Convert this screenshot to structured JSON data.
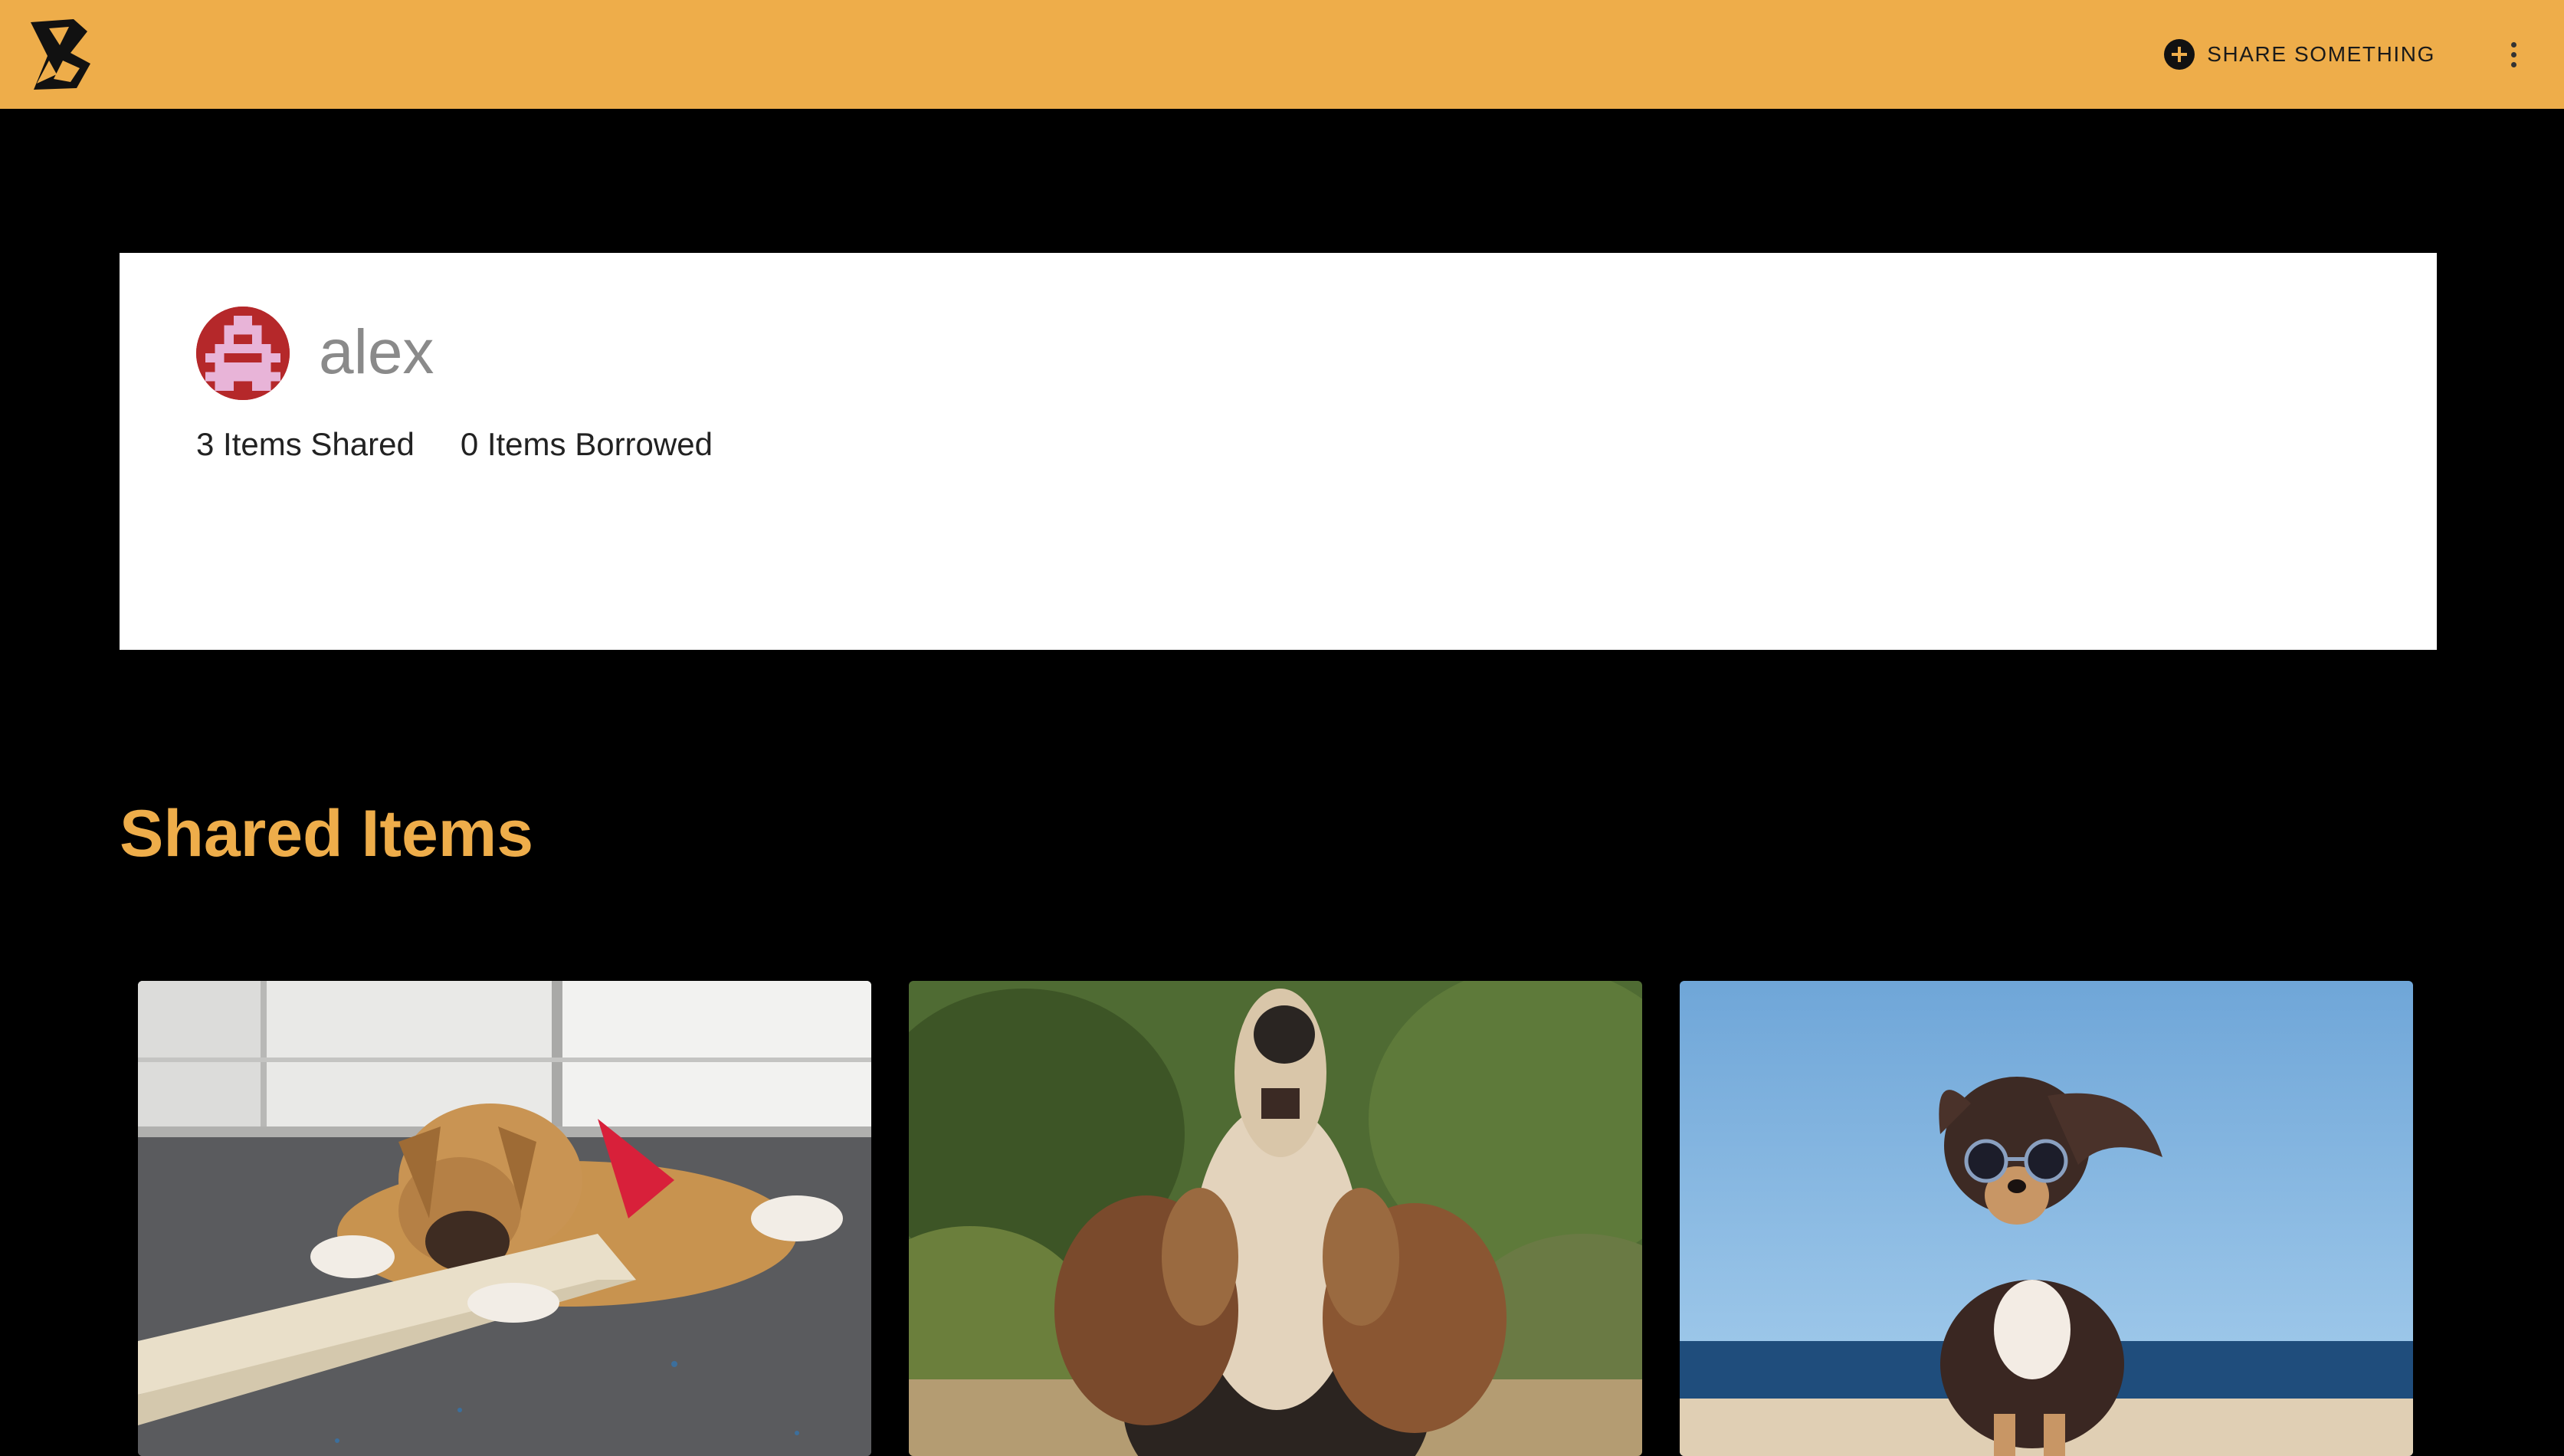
{
  "appbar": {
    "logo_icon": "boomtown-logo-icon",
    "share_button_label": "SHARE SOMETHING",
    "share_icon": "plus-circle-icon",
    "menu_icon": "more-vert-icon",
    "background_color": "#EEAD4A"
  },
  "profile": {
    "username": "alex",
    "avatar_icon": "identicon-avatar",
    "items_shared": "3 Items Shared",
    "items_borrowed": "0 Items Borrowed"
  },
  "shared_section": {
    "title": "Shared Items",
    "title_color": "#EEAD4A",
    "items": [
      {
        "image": "puppy-chewing-stick-photo"
      },
      {
        "image": "howling-beagle-photo"
      },
      {
        "image": "chihuahua-sunglasses-beach-photo"
      }
    ]
  }
}
